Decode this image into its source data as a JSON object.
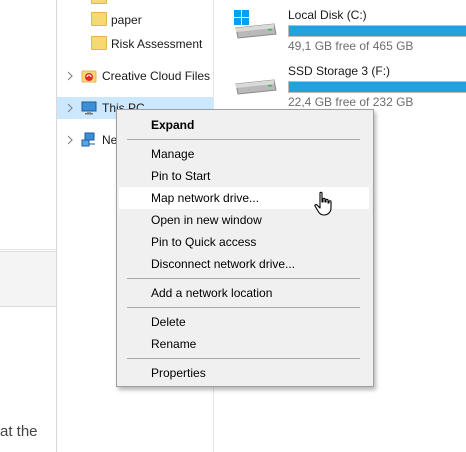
{
  "background_page": {
    "partial_text": "at the"
  },
  "navigation": {
    "items": [
      {
        "label": "paper",
        "icon": "folder-icon"
      },
      {
        "label": "Risk Assessment",
        "icon": "folder-icon"
      },
      {
        "label": "Creative Cloud Files",
        "icon": "creative-cloud-icon"
      },
      {
        "label": "This PC",
        "icon": "computer-icon",
        "selected": true
      },
      {
        "label": "Ne",
        "icon": "network-icon"
      }
    ]
  },
  "drives": [
    {
      "name": "Local Disk (C:)",
      "free_text": "49,1 GB free of 465 GB",
      "used_fraction": 0.894,
      "icon": "windows-drive-icon"
    },
    {
      "name": "SSD Storage 3 (F:)",
      "free_text": "22,4 GB free of 232 GB",
      "used_fraction": 0.903,
      "icon": "drive-icon"
    }
  ],
  "context_menu": {
    "items": [
      {
        "label": "Expand",
        "bold": true
      },
      {
        "label": "Manage"
      },
      {
        "label": "Pin to Start"
      },
      {
        "label": "Map network drive...",
        "hover": true
      },
      {
        "label": "Open in new window"
      },
      {
        "label": "Pin to Quick access"
      },
      {
        "label": "Disconnect network drive..."
      },
      {
        "label": "Add a network location"
      },
      {
        "label": "Delete"
      },
      {
        "label": "Rename"
      },
      {
        "label": "Properties"
      }
    ]
  },
  "colors": {
    "selection": "#cce8ff",
    "drive_bar_fill": "#26a0da",
    "menu_background": "#f0f0f0",
    "folder_yellow": "#f8d775"
  }
}
